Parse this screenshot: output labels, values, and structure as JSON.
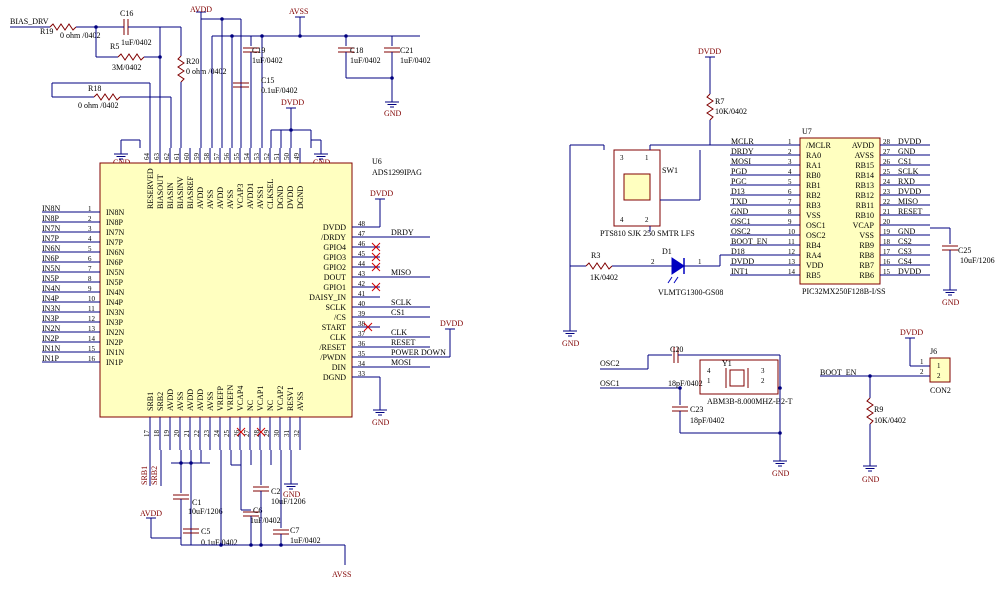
{
  "colors": {
    "wire": "#000080",
    "part": "#800000",
    "body": "#ffffc0",
    "text": "#000000",
    "noconnect": "#d00000"
  },
  "u6": {
    "ref": "U6",
    "part": "ADS1299IPAG",
    "left_pins": [
      {
        "n": "1",
        "name": "IN8N",
        "net": "IN8N"
      },
      {
        "n": "2",
        "name": "IN8P",
        "net": "IN8P"
      },
      {
        "n": "3",
        "name": "IN7N",
        "net": "IN7N"
      },
      {
        "n": "4",
        "name": "IN7P",
        "net": "IN7P"
      },
      {
        "n": "5",
        "name": "IN6N",
        "net": "IN6N"
      },
      {
        "n": "6",
        "name": "IN6P",
        "net": "IN6P"
      },
      {
        "n": "7",
        "name": "IN5N",
        "net": "IN5N"
      },
      {
        "n": "8",
        "name": "IN5P",
        "net": "IN5P"
      },
      {
        "n": "9",
        "name": "IN4N",
        "net": "IN4N"
      },
      {
        "n": "10",
        "name": "IN4P",
        "net": "IN4P"
      },
      {
        "n": "11",
        "name": "IN3N",
        "net": "IN3N"
      },
      {
        "n": "12",
        "name": "IN3P",
        "net": "IN3P"
      },
      {
        "n": "13",
        "name": "IN2N",
        "net": "IN2N"
      },
      {
        "n": "14",
        "name": "IN2P",
        "net": "IN2P"
      },
      {
        "n": "15",
        "name": "IN1N",
        "net": "IN1N"
      },
      {
        "n": "16",
        "name": "IN1P",
        "net": "IN1P"
      }
    ],
    "right_pins": [
      {
        "n": "48",
        "name": "DVDD",
        "net": ""
      },
      {
        "n": "47",
        "name": "/DRDY",
        "net": "DRDY"
      },
      {
        "n": "46",
        "name": "GPIO4",
        "net": ""
      },
      {
        "n": "45",
        "name": "GPIO3",
        "net": ""
      },
      {
        "n": "44",
        "name": "GPIO2",
        "net": ""
      },
      {
        "n": "43",
        "name": "DOUT",
        "net": "MISO"
      },
      {
        "n": "42",
        "name": "GPIO1",
        "net": ""
      },
      {
        "n": "41",
        "name": "DAISY_IN",
        "net": ""
      },
      {
        "n": "40",
        "name": "SCLK",
        "net": "SCLK"
      },
      {
        "n": "39",
        "name": "/CS",
        "net": "CS1"
      },
      {
        "n": "38",
        "name": "START",
        "net": ""
      },
      {
        "n": "37",
        "name": "CLK",
        "net": "CLK"
      },
      {
        "n": "36",
        "name": "/RESET",
        "net": "RESET"
      },
      {
        "n": "35",
        "name": "/PWDN",
        "net": "POWER DOWN"
      },
      {
        "n": "34",
        "name": "DIN",
        "net": "MOSI"
      },
      {
        "n": "33",
        "name": "DGND",
        "net": ""
      }
    ],
    "top_pins": [
      {
        "n": "64",
        "name": "RESERVED"
      },
      {
        "n": "63",
        "name": "BIASOUT"
      },
      {
        "n": "62",
        "name": "BIASIN"
      },
      {
        "n": "61",
        "name": "BIASINV"
      },
      {
        "n": "60",
        "name": "BIASREF"
      },
      {
        "n": "59",
        "name": "AVDD"
      },
      {
        "n": "58",
        "name": "AVSS"
      },
      {
        "n": "57",
        "name": "AVDD"
      },
      {
        "n": "56",
        "name": "AVSS"
      },
      {
        "n": "55",
        "name": "VCAP3"
      },
      {
        "n": "54",
        "name": "AVDD1"
      },
      {
        "n": "53",
        "name": "AVSS1"
      },
      {
        "n": "52",
        "name": "CLKSEL"
      },
      {
        "n": "51",
        "name": "DGND"
      },
      {
        "n": "50",
        "name": "DVDD"
      },
      {
        "n": "49",
        "name": "DGND"
      }
    ],
    "bottom_pins": [
      {
        "n": "17",
        "name": "SRB1"
      },
      {
        "n": "18",
        "name": "SRB2"
      },
      {
        "n": "19",
        "name": "AVDD"
      },
      {
        "n": "20",
        "name": "AVSS"
      },
      {
        "n": "21",
        "name": "AVDD"
      },
      {
        "n": "22",
        "name": "AVDD"
      },
      {
        "n": "23",
        "name": "AVSS"
      },
      {
        "n": "24",
        "name": "VREFP"
      },
      {
        "n": "25",
        "name": "VREFN"
      },
      {
        "n": "26",
        "name": "VCAP4"
      },
      {
        "n": "27",
        "name": "NC"
      },
      {
        "n": "28",
        "name": "VCAP1"
      },
      {
        "n": "29",
        "name": "NC"
      },
      {
        "n": "30",
        "name": "VCAP2"
      },
      {
        "n": "31",
        "name": "RESV1"
      },
      {
        "n": "32",
        "name": "AVSS"
      }
    ]
  },
  "u7": {
    "ref": "U7",
    "part": "PIC32MX250F128B-I/SS",
    "left_pins": [
      {
        "n": "1",
        "name": "/MCLR",
        "net": "MCLR"
      },
      {
        "n": "2",
        "name": "RA0",
        "net": "DRDY"
      },
      {
        "n": "3",
        "name": "RA1",
        "net": "MOSI"
      },
      {
        "n": "4",
        "name": "RB0",
        "net": "PGD"
      },
      {
        "n": "5",
        "name": "RB1",
        "net": "PGC"
      },
      {
        "n": "6",
        "name": "RB2",
        "net": "D13"
      },
      {
        "n": "7",
        "name": "RB3",
        "net": "TXD"
      },
      {
        "n": "8",
        "name": "VSS",
        "net": "GND"
      },
      {
        "n": "9",
        "name": "OSC1",
        "net": "OSC1"
      },
      {
        "n": "10",
        "name": "OSC2",
        "net": "OSC2"
      },
      {
        "n": "11",
        "name": "RB4",
        "net": "BOOT_EN"
      },
      {
        "n": "12",
        "name": "RA4",
        "net": "D18"
      },
      {
        "n": "13",
        "name": "VDD",
        "net": "DVDD"
      },
      {
        "n": "14",
        "name": "RB5",
        "net": "INT1"
      }
    ],
    "right_pins": [
      {
        "n": "28",
        "name": "AVDD",
        "net": "DVDD"
      },
      {
        "n": "27",
        "name": "AVSS",
        "net": "GND"
      },
      {
        "n": "26",
        "name": "RB15",
        "net": "CS1"
      },
      {
        "n": "25",
        "name": "RB14",
        "net": "SCLK"
      },
      {
        "n": "24",
        "name": "RB13",
        "net": "RXD"
      },
      {
        "n": "23",
        "name": "RB12",
        "net": "DVDD"
      },
      {
        "n": "22",
        "name": "RB11",
        "net": "MISO"
      },
      {
        "n": "21",
        "name": "RB10",
        "net": "RESET"
      },
      {
        "n": "20",
        "name": "VCAP",
        "net": ""
      },
      {
        "n": "19",
        "name": "VSS",
        "net": "GND"
      },
      {
        "n": "18",
        "name": "RB9",
        "net": "CS2"
      },
      {
        "n": "17",
        "name": "RB8",
        "net": "CS3"
      },
      {
        "n": "16",
        "name": "RB7",
        "net": "CS4"
      },
      {
        "n": "15",
        "name": "RB6",
        "net": "DVDD"
      }
    ]
  },
  "parts": {
    "c16": {
      "ref": "C16",
      "val": "1uF/0402"
    },
    "r19": {
      "ref": "R19",
      "val": "0 ohm /0402"
    },
    "r5": {
      "ref": "R5",
      "val": "3M/0402"
    },
    "r20": {
      "ref": "R20",
      "val": "0 ohm /0402"
    },
    "r18": {
      "ref": "R18",
      "val": "0 ohm /0402"
    },
    "c19": {
      "ref": "C19",
      "val": "1uF/0402"
    },
    "c15": {
      "ref": "C15",
      "val": "0.1uF/0402"
    },
    "c18": {
      "ref": "C18",
      "val": "1uF/0402"
    },
    "c21": {
      "ref": "C21",
      "val": "1uF/0402"
    },
    "c1": {
      "ref": "C1",
      "val": "10uF/1206"
    },
    "c5": {
      "ref": "C5",
      "val": "0.1uF/0402"
    },
    "c6": {
      "ref": "C6",
      "val": "1uF/0402"
    },
    "c2": {
      "ref": "C2",
      "val": "10uF/1206"
    },
    "c7": {
      "ref": "C7",
      "val": "1uF/0402"
    },
    "r7": {
      "ref": "R7",
      "val": "10K/0402"
    },
    "sw1": {
      "ref": "SW1",
      "val": "PTS810 SJK 250 SMTR LFS",
      "pins": [
        "3",
        "1",
        "4",
        "2"
      ]
    },
    "r3": {
      "ref": "R3",
      "val": "1K/0402"
    },
    "d1": {
      "ref": "D1",
      "val": "VLMTG1300-GS08",
      "pins": [
        "2",
        "1"
      ]
    },
    "c25": {
      "ref": "C25",
      "val": "10uF/1206"
    },
    "c20": {
      "ref": "C20",
      "val": ""
    },
    "y1": {
      "ref": "Y1",
      "val": "ABM3B-8.000MHZ-B2-T",
      "pins": [
        "4",
        "3",
        "1",
        "2"
      ]
    },
    "c22": {
      "val": "18pF/0402"
    },
    "c23": {
      "ref": "C23",
      "val": "18pF/0402"
    },
    "r9": {
      "ref": "R9",
      "val": "10K/0402"
    },
    "j6": {
      "ref": "J6",
      "val": "CON2",
      "pins": [
        "1",
        "2"
      ]
    }
  },
  "labels": {
    "bias_drv": "BIAS_DRV",
    "avdd": "AVDD",
    "avss": "AVSS",
    "dvdd": "DVDD",
    "gnd": "GND",
    "srb1": "SRB1",
    "srb2": "SRB2",
    "osc1": "OSC1",
    "osc2": "OSC2",
    "boot_en": "BOOT_EN"
  }
}
